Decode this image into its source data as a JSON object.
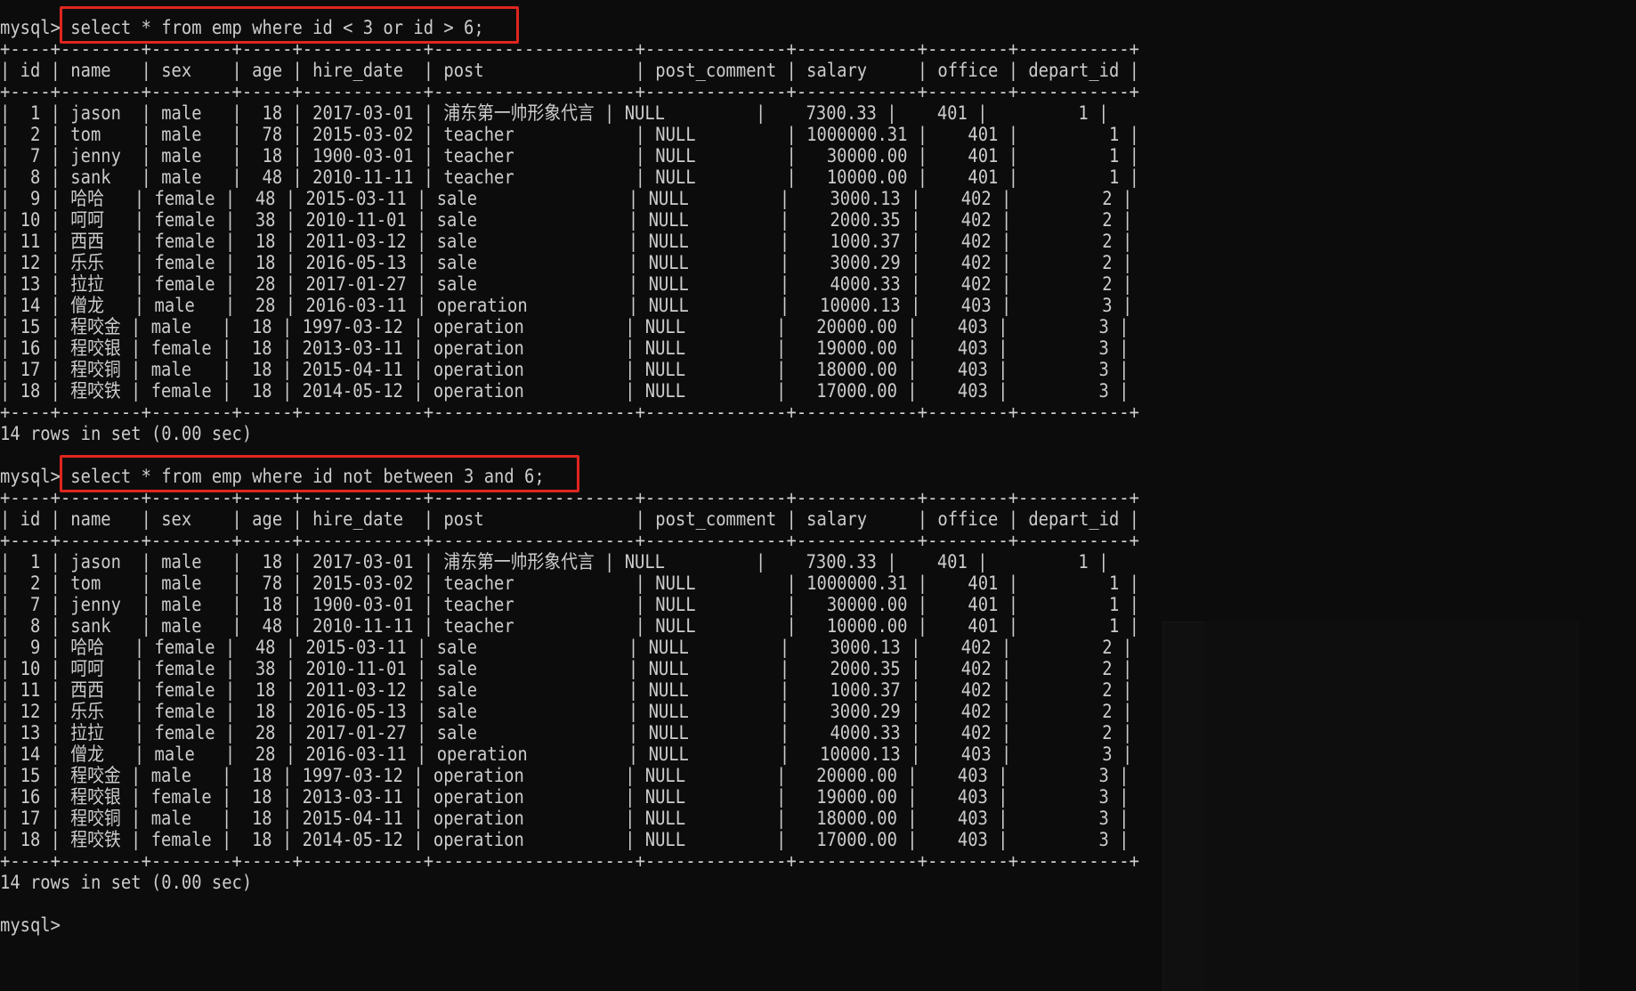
{
  "terminal": {
    "prompt": "mysql>",
    "highlight_color": "#e0251f",
    "text_color": "#cccccc",
    "background": "#0c0c0c"
  },
  "queries": [
    {
      "command": "select * from emp where id < 3 or id > 6;",
      "result_summary": "14 rows in set (0.00 sec)"
    },
    {
      "command": "select * from emp where id not between 3 and 6;",
      "result_summary": "14 rows in set (0.00 sec)"
    }
  ],
  "table": {
    "columns": [
      "id",
      "name",
      "sex",
      "age",
      "hire_date",
      "post",
      "post_comment",
      "salary",
      "office",
      "depart_id"
    ],
    "rows": [
      [
        "1",
        "jason",
        "male",
        "18",
        "2017-03-01",
        "浦东第一帅形象代言",
        "NULL",
        "7300.33",
        "401",
        "1"
      ],
      [
        "2",
        "tom",
        "male",
        "78",
        "2015-03-02",
        "teacher",
        "NULL",
        "1000000.31",
        "401",
        "1"
      ],
      [
        "7",
        "jenny",
        "male",
        "18",
        "1900-03-01",
        "teacher",
        "NULL",
        "30000.00",
        "401",
        "1"
      ],
      [
        "8",
        "sank",
        "male",
        "48",
        "2010-11-11",
        "teacher",
        "NULL",
        "10000.00",
        "401",
        "1"
      ],
      [
        "9",
        "哈哈",
        "female",
        "48",
        "2015-03-11",
        "sale",
        "NULL",
        "3000.13",
        "402",
        "2"
      ],
      [
        "10",
        "呵呵",
        "female",
        "38",
        "2010-11-01",
        "sale",
        "NULL",
        "2000.35",
        "402",
        "2"
      ],
      [
        "11",
        "西西",
        "female",
        "18",
        "2011-03-12",
        "sale",
        "NULL",
        "1000.37",
        "402",
        "2"
      ],
      [
        "12",
        "乐乐",
        "female",
        "18",
        "2016-05-13",
        "sale",
        "NULL",
        "3000.29",
        "402",
        "2"
      ],
      [
        "13",
        "拉拉",
        "female",
        "28",
        "2017-01-27",
        "sale",
        "NULL",
        "4000.33",
        "402",
        "2"
      ],
      [
        "14",
        "僧龙",
        "male",
        "28",
        "2016-03-11",
        "operation",
        "NULL",
        "10000.13",
        "403",
        "3"
      ],
      [
        "15",
        "程咬金",
        "male",
        "18",
        "1997-03-12",
        "operation",
        "NULL",
        "20000.00",
        "403",
        "3"
      ],
      [
        "16",
        "程咬银",
        "female",
        "18",
        "2013-03-11",
        "operation",
        "NULL",
        "19000.00",
        "403",
        "3"
      ],
      [
        "17",
        "程咬铜",
        "male",
        "18",
        "2015-04-11",
        "operation",
        "NULL",
        "18000.00",
        "403",
        "3"
      ],
      [
        "18",
        "程咬铁",
        "female",
        "18",
        "2014-05-12",
        "operation",
        "NULL",
        "17000.00",
        "403",
        "3"
      ]
    ]
  },
  "final_prompt": "mysql>"
}
